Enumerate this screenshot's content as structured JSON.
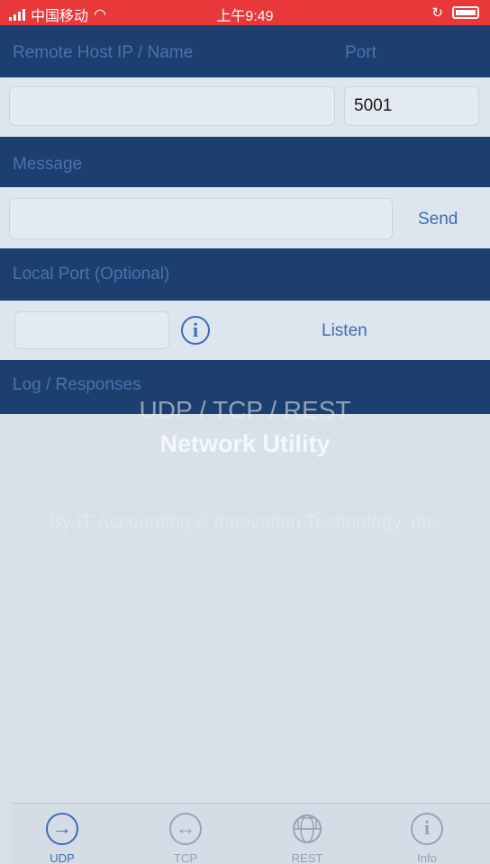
{
  "status_bar": {
    "carrier": "中国移动",
    "time": "上午9:49"
  },
  "remote_host": {
    "host_label": "Remote Host IP / Name",
    "port_label": "Port",
    "host_value": "",
    "port_value": "5001"
  },
  "message": {
    "label": "Message",
    "value": "",
    "send_label": "Send"
  },
  "local_port": {
    "label": "Local Port (Optional)",
    "value": "",
    "listen_label": "Listen"
  },
  "log": {
    "label": "Log / Responses"
  },
  "splash": {
    "subtitle": "UDP / TCP / REST",
    "title": "Network Utility",
    "byline": "By IT Accounting & Innovation Technology, Inc."
  },
  "tabs": [
    {
      "label": "UDP",
      "icon": "udp-arrow-icon",
      "active": true
    },
    {
      "label": "TCP",
      "icon": "tcp-double-arrow-icon",
      "active": false
    },
    {
      "label": "REST",
      "icon": "rest-globe-icon",
      "active": false
    },
    {
      "label": "Info",
      "icon": "info-icon",
      "active": false
    }
  ],
  "colors": {
    "status_bar": "#e8383a",
    "header_panel": "#1d3f70",
    "accent": "#3f6db0",
    "row_background": "#dde5ee"
  }
}
